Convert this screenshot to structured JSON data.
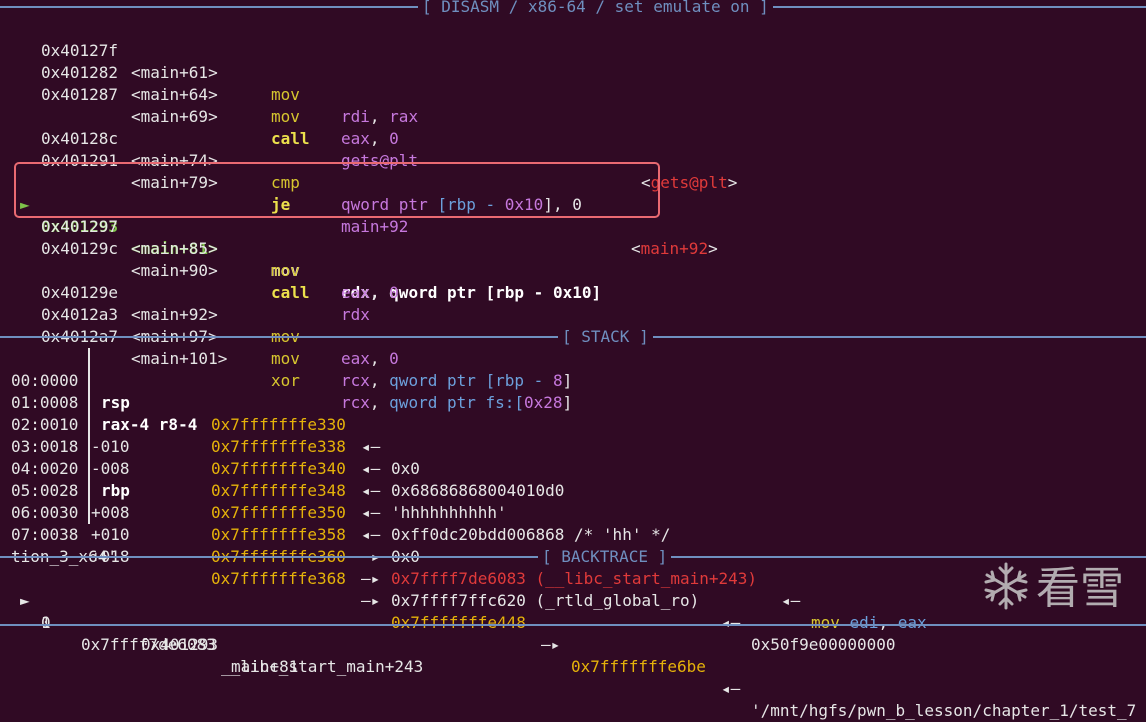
{
  "sections": {
    "disasm": "[ DISASM / x86-64 / set emulate on ]",
    "stack": "[ STACK ]",
    "backtrace": "[ BACKTRACE ]"
  },
  "disasm": [
    {
      "addr": "0x40127f",
      "sym": "<main+61>",
      "mn": "mov",
      "a": "rdi",
      "c": ", ",
      "b": "rax"
    },
    {
      "addr": "0x401282",
      "sym": "<main+64>",
      "mn": "mov",
      "a": "eax",
      "c": ", ",
      "b": "0"
    },
    {
      "addr": "0x401287",
      "sym": "<main+69>",
      "mn": "call",
      "a": "gets@plt",
      "target": "gets@plt"
    },
    {
      "addr": "0x40128c",
      "sym": "<main+74>",
      "mn": "cmp",
      "a": "qword ptr",
      "b": "[rbp - ",
      "n": "0x10",
      "e": "], 0"
    },
    {
      "addr": "0x401291",
      "sym": "<main+79>",
      "mn": "je",
      "a": "main+92",
      "target": "main+92"
    },
    {
      "marker": "►",
      "addr": "0x401293",
      "sym": "<main+81>",
      "mn": "mov",
      "a": "rdx",
      "c": ", ",
      "b": "qword ptr [rbp - ",
      "n": "0x10",
      "e": "]"
    },
    {
      "addr": "0x401297",
      "sym": "<main+85>",
      "mn": "mov",
      "a": "eax",
      "c": ", ",
      "b": "0"
    },
    {
      "addr": "0x40129c",
      "sym": "<main+90>",
      "mn": "call",
      "a": "rdx"
    },
    {
      "addr": "0x40129e",
      "sym": "<main+92>",
      "mn": "mov",
      "a": "eax",
      "c": ", ",
      "b": "0"
    },
    {
      "addr": "0x4012a3",
      "sym": "<main+97>",
      "mn": "mov",
      "a": "rcx",
      "c": ", ",
      "b": "qword ptr [rbp - ",
      "n": "8",
      "e": "]"
    },
    {
      "addr": "0x4012a7",
      "sym": "<main+101>",
      "mn": "xor",
      "a": "rcx",
      "c": ", ",
      "b": "qword ptr fs:[",
      "n": "0x28",
      "e": "]"
    }
  ],
  "stack": [
    {
      "idx": "00:0000",
      "reg": "rsp",
      "addr": "0x7fffffffe330",
      "arrow": "◂—",
      "val": "0x0"
    },
    {
      "idx": "01:0008",
      "reg": "rax-4 r8-4",
      "addr": "0x7fffffffe338",
      "arrow": "◂—",
      "val": "0x68686868004010d0"
    },
    {
      "idx": "02:0010",
      "reg": "-010",
      "addr": "0x7fffffffe340",
      "arrow": "◂—",
      "val": "'hhhhhhhhhh'"
    },
    {
      "idx": "03:0018",
      "reg": "-008",
      "addr": "0x7fffffffe348",
      "arrow": "◂—",
      "val": "0xff0dc20bdd006868 /* 'hh' */"
    },
    {
      "idx": "04:0020",
      "reg": "rbp",
      "addr": "0x7fffffffe350",
      "arrow": "◂—",
      "val": "0x0"
    },
    {
      "idx": "05:0028",
      "reg": "+008",
      "addr": "0x7fffffffe358",
      "arrow": "—▸",
      "v1": "0x7ffff7de6083 (__libc_start_main+243)",
      "arrow2": "◂—",
      "v2a": "mov",
      "v2b": "edi",
      "v2c": ", ",
      "v2d": "eax"
    },
    {
      "idx": "06:0030",
      "reg": "+010",
      "addr": "0x7fffffffe360",
      "arrow": "—▸",
      "val": "0x7ffff7ffc620 (_rtld_global_ro)",
      "arrow2": "◂—",
      "val2": "0x50f9e00000000"
    },
    {
      "idx": "07:0038",
      "reg": "+018",
      "addr": "0x7fffffffe368",
      "arrow": "—▸",
      "v1": "0x7fffffffe448",
      "arrow2": "—▸",
      "v2": "0x7fffffffe6be",
      "arrow3": "◂—",
      "val3": "'/mnt/hgfs/pwn_b_lesson/chapter_1/test_7",
      "cont": "tion_3_x64'"
    }
  ],
  "backtrace": [
    {
      "marker": "►",
      "num": "0",
      "addr": "0x401293",
      "func": "main+81"
    },
    {
      "num": "1",
      "addr": "0x7ffff7de6083",
      "func": "__libc_start_main+243"
    }
  ],
  "watermark": {
    "icon": "snowflake-icon",
    "text": "看雪"
  }
}
